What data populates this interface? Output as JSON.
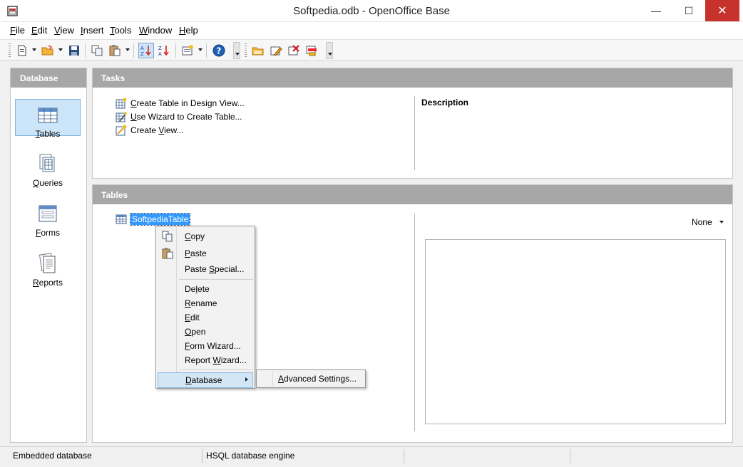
{
  "window": {
    "title": "Softpedia.odb - OpenOffice Base",
    "minimize_glyph": "—",
    "maximize_glyph": "☐",
    "close_glyph": "✕"
  },
  "menu": {
    "items": [
      {
        "key": "F",
        "rest": "ile"
      },
      {
        "key": "E",
        "rest": "dit"
      },
      {
        "key": "V",
        "rest": "iew"
      },
      {
        "key": "I",
        "rest": "nsert"
      },
      {
        "key": "T",
        "rest": "ools"
      },
      {
        "key": "W",
        "rest": "indow"
      },
      {
        "key": "H",
        "rest": "elp"
      }
    ]
  },
  "toolbar": {
    "icons": [
      "new-document-icon",
      "open-folder-icon",
      "save-icon",
      "copy-icon",
      "paste-icon",
      "sort-ascending-icon",
      "sort-descending-icon",
      "form-icon",
      "help-icon",
      "open-database-object-icon",
      "edit-icon",
      "delete-icon",
      "rename-icon"
    ],
    "help_glyph": "?"
  },
  "database_pane": {
    "header": "Database",
    "items": [
      {
        "key": "T",
        "rest": "ables",
        "icon": "tables-icon",
        "selected": true
      },
      {
        "key": "Q",
        "rest": "ueries",
        "icon": "queries-icon",
        "selected": false
      },
      {
        "key": "F",
        "rest": "orms",
        "icon": "forms-icon",
        "selected": false
      },
      {
        "key": "R",
        "rest": "eports",
        "icon": "reports-icon",
        "selected": false
      }
    ]
  },
  "tasks": {
    "header": "Tasks",
    "items": [
      {
        "key": "C",
        "rest": "reate Table in Design View...",
        "icon": "design-table-icon"
      },
      {
        "key": "U",
        "rest": "se Wizard to Create Table...",
        "icon": "wizard-icon"
      },
      {
        "pre": "Create ",
        "key": "V",
        "rest": "iew...",
        "icon": "create-view-icon"
      }
    ],
    "description_title": "Description"
  },
  "tables": {
    "header": "Tables",
    "tree_item": "SoftpediaTable",
    "preview_mode": "None"
  },
  "context_menu": {
    "items": [
      {
        "pre": "",
        "key": "C",
        "rest": "opy",
        "icon": "copy-icon"
      },
      {
        "pre": "",
        "key": "P",
        "rest": "aste",
        "icon": "paste-icon"
      },
      {
        "pre": "Paste ",
        "key": "S",
        "rest": "pecial...",
        "icon": ""
      },
      {
        "pre": "De",
        "key": "l",
        "rest": "ete",
        "icon": ""
      },
      {
        "pre": "",
        "key": "R",
        "rest": "ename",
        "icon": ""
      },
      {
        "pre": "",
        "key": "E",
        "rest": "dit",
        "icon": ""
      },
      {
        "pre": "",
        "key": "O",
        "rest": "pen",
        "icon": ""
      },
      {
        "pre": "",
        "key": "F",
        "rest": "orm Wizard...",
        "icon": ""
      },
      {
        "pre": "Report ",
        "key": "W",
        "rest": "izard...",
        "icon": ""
      },
      {
        "pre": "",
        "key": "D",
        "rest": "atabase",
        "icon": ""
      }
    ],
    "submenu": {
      "key": "A",
      "rest": "dvanced Settings..."
    }
  },
  "status": {
    "left": "Embedded database",
    "middle": "HSQL database engine"
  },
  "colors": {
    "accent": "#3399ff",
    "header_gray": "#a7a7a7",
    "close_red": "#c7332c",
    "selection_bg": "#cde5f8"
  }
}
